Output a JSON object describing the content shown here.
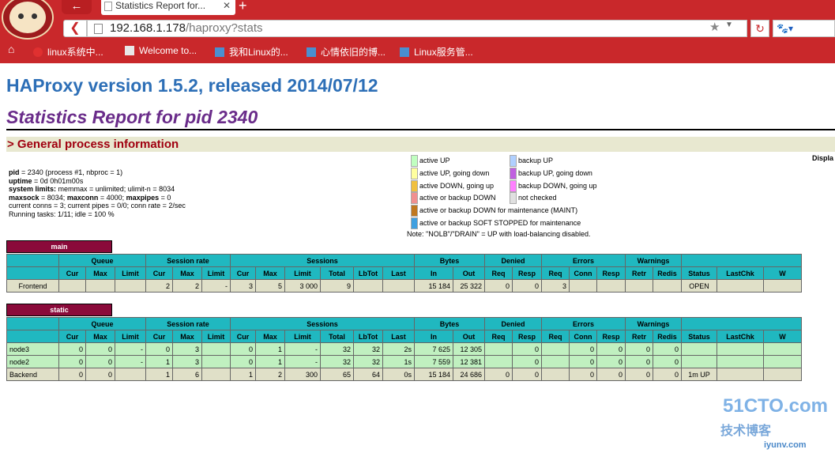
{
  "browser": {
    "tab_title": "Statistics Report for...",
    "back_glyph": "←",
    "close_glyph": "✕",
    "newtab_glyph": "+",
    "url_host": "192.168.1.178",
    "url_path": "/haproxy?stats",
    "bookmarks": [
      "linux系统中...",
      "Welcome to...",
      "我和Linux的...",
      "心情依旧的博...",
      "Linux服务管..."
    ]
  },
  "page": {
    "title": "HAProxy version 1.5.2, released 2014/07/12",
    "subtitle": "Statistics Report for pid 2340",
    "section": "> General process information",
    "display": "Displa"
  },
  "info": {
    "pid_label": "pid",
    "pid_value": " = 2340 (process #1, nbproc = 1)",
    "uptime_label": "uptime",
    "uptime_value": " = 0d 0h01m00s",
    "limits_label": "system limits:",
    "limits_value": " memmax = unlimited; ulimit-n = 8034",
    "maxsock_label": "maxsock",
    "maxsock_value": " = 8034; ",
    "maxconn_label": "maxconn",
    "maxconn_value": " = 4000; ",
    "maxpipes_label": "maxpipes",
    "maxpipes_value": " = 0",
    "conns": "current conns = 3; current pipes = 0/0; conn rate = 2/sec",
    "tasks": "Running tasks: 1/11; idle = 100 %"
  },
  "legend": {
    "left": [
      {
        "label": "active UP",
        "color": "#c0ffc0"
      },
      {
        "label": "active UP, going down",
        "color": "#ffffa0"
      },
      {
        "label": "active DOWN, going up",
        "color": "#f0c040"
      },
      {
        "label": "active or backup DOWN",
        "color": "#f09090"
      },
      {
        "label": "active or backup DOWN for maintenance (MAINT)",
        "color": "#c07820"
      },
      {
        "label": "active or backup SOFT STOPPED for maintenance",
        "color": "#40a0e0"
      }
    ],
    "right": [
      {
        "label": "backup UP",
        "color": "#b0d0ff"
      },
      {
        "label": "backup UP, going down",
        "color": "#c060e0"
      },
      {
        "label": "backup DOWN, going up",
        "color": "#ff80ff"
      },
      {
        "label": "not checked",
        "color": "#e0e0e0"
      }
    ],
    "note": "Note: \"NOLB\"/\"DRAIN\" = UP with load-balancing disabled."
  },
  "groups": [
    "Queue",
    "Session rate",
    "Sessions",
    "Bytes",
    "Denied",
    "Errors",
    "Warnings"
  ],
  "headers": [
    "Cur",
    "Max",
    "Limit",
    "Cur",
    "Max",
    "Limit",
    "Cur",
    "Max",
    "Limit",
    "Total",
    "LbTot",
    "Last",
    "In",
    "Out",
    "Req",
    "Resp",
    "Req",
    "Conn",
    "Resp",
    "Retr",
    "Redis",
    "Status",
    "LastChk",
    "W"
  ],
  "main": {
    "name": "main",
    "row": {
      "name": "Frontend",
      "cells": [
        "",
        "",
        "",
        "2",
        "2",
        "-",
        "3",
        "5",
        "3 000",
        "9",
        "",
        "",
        "15 184",
        "25 322",
        "0",
        "0",
        "3",
        "",
        "",
        "",
        "",
        "OPEN",
        "",
        ""
      ]
    }
  },
  "static": {
    "name": "static",
    "rows": [
      {
        "name": "node3",
        "cells": [
          "0",
          "0",
          "-",
          "0",
          "3",
          "",
          "0",
          "1",
          "-",
          "32",
          "32",
          "2s",
          "7 625",
          "12 305",
          "",
          "0",
          "",
          "0",
          "0",
          "0",
          "0",
          "",
          "",
          ""
        ]
      },
      {
        "name": "node2",
        "cells": [
          "0",
          "0",
          "-",
          "1",
          "3",
          "",
          "0",
          "1",
          "-",
          "32",
          "32",
          "1s",
          "7 559",
          "12 381",
          "",
          "0",
          "",
          "0",
          "0",
          "0",
          "0",
          "",
          "",
          ""
        ]
      },
      {
        "name": "Backend",
        "cells": [
          "0",
          "0",
          "",
          "1",
          "6",
          "",
          "1",
          "2",
          "300",
          "65",
          "64",
          "0s",
          "15 184",
          "24 686",
          "0",
          "0",
          "",
          "0",
          "0",
          "0",
          "0",
          "1m UP",
          "",
          ""
        ]
      }
    ]
  },
  "watermark": {
    "line1": "51CTO.com",
    "line2": "技术博客",
    "line3": "iyunv.com"
  }
}
